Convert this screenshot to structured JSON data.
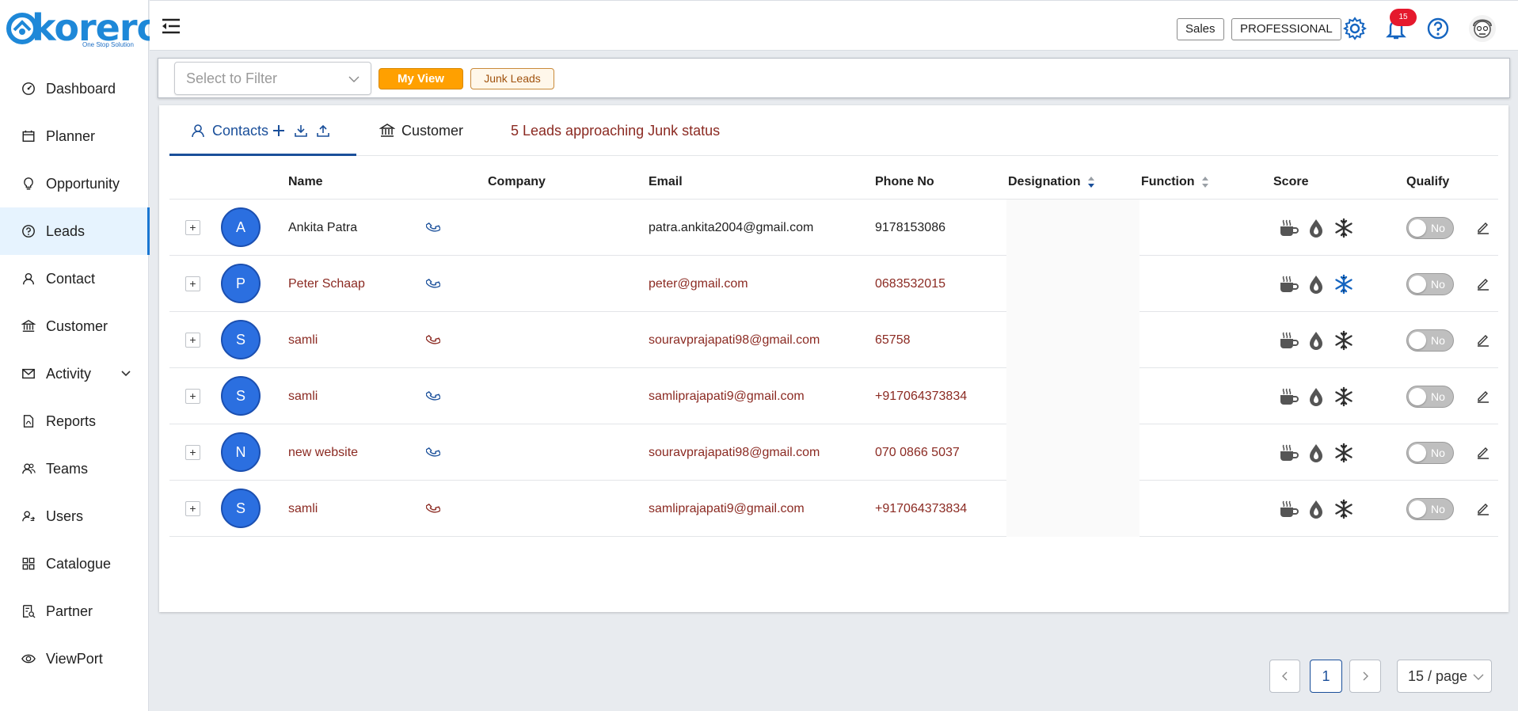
{
  "brand": {
    "name": "korero",
    "tagline": "One Stop Solution",
    "color": "#1e88d8"
  },
  "sidebar": {
    "items": [
      {
        "label": "Dashboard",
        "icon": "dashboard-icon"
      },
      {
        "label": "Planner",
        "icon": "calendar-icon"
      },
      {
        "label": "Opportunity",
        "icon": "lightbulb-icon"
      },
      {
        "label": "Leads",
        "icon": "question-circle-icon",
        "active": true
      },
      {
        "label": "Contact",
        "icon": "user-icon"
      },
      {
        "label": "Customer",
        "icon": "bank-icon"
      },
      {
        "label": "Activity",
        "icon": "mail-icon",
        "has_submenu": true
      },
      {
        "label": "Reports",
        "icon": "file-pdf-icon"
      },
      {
        "label": "Teams",
        "icon": "team-icon"
      },
      {
        "label": "Users",
        "icon": "user-switch-icon"
      },
      {
        "label": "Catalogue",
        "icon": "grid-icon"
      },
      {
        "label": "Partner",
        "icon": "partner-icon"
      },
      {
        "label": "ViewPort",
        "icon": "eye-icon"
      }
    ]
  },
  "topbar": {
    "role_tag": "Sales",
    "plan_tag": "PROFESSIONAL",
    "notification_count": "15",
    "accent_color": "#1565c0"
  },
  "filterbar": {
    "select_placeholder": "Select to Filter",
    "my_view_label": "My View",
    "junk_leads_label": "Junk Leads"
  },
  "tabs": {
    "contacts_label": "Contacts",
    "customer_label": "Customer",
    "junk_warning": "5 Leads approaching Junk status"
  },
  "table": {
    "columns": [
      "Name",
      "Company",
      "Email",
      "Phone No",
      "Designation",
      "Function",
      "Score",
      "Qualify"
    ],
    "rows": [
      {
        "initial": "A",
        "name": "Ankita Patra",
        "company": "",
        "email": "patra.ankita2004@gmail.com",
        "phone": "9178153086",
        "highlight": false,
        "phone_status": "blue",
        "snow_active": false,
        "qualify": "No"
      },
      {
        "initial": "P",
        "name": "Peter Schaap",
        "company": "",
        "email": "peter@gmail.com",
        "phone": "0683532015",
        "highlight": true,
        "phone_status": "blue",
        "snow_active": true,
        "qualify": "No"
      },
      {
        "initial": "S",
        "name": "samli",
        "company": "",
        "email": "souravprajapati98@gmail.com",
        "phone": "65758",
        "highlight": true,
        "phone_status": "red",
        "snow_active": false,
        "qualify": "No"
      },
      {
        "initial": "S",
        "name": "samli",
        "company": "",
        "email": "samliprajapati9@gmail.com",
        "phone": "+917064373834",
        "highlight": true,
        "phone_status": "blue",
        "snow_active": false,
        "qualify": "No"
      },
      {
        "initial": "N",
        "name": "new website",
        "company": "",
        "email": "souravprajapati98@gmail.com",
        "phone": "070 0866 5037",
        "highlight": true,
        "phone_status": "blue",
        "snow_active": false,
        "qualify": "No"
      },
      {
        "initial": "S",
        "name": "samli",
        "company": "",
        "email": "samliprajapati9@gmail.com",
        "phone": "+917064373834",
        "highlight": true,
        "phone_status": "red",
        "snow_active": false,
        "qualify": "No"
      }
    ]
  },
  "pagination": {
    "current_page": "1",
    "page_size": "15 / page"
  },
  "colors": {
    "lead_red": "#8b2a22",
    "avatar_blue": "#2b6fe0",
    "my_view_orange": "#ffa000"
  }
}
